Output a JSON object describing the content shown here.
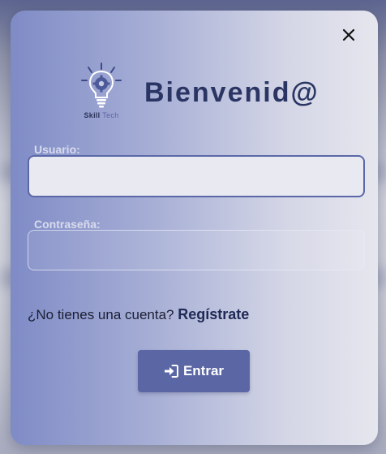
{
  "modal": {
    "brand": {
      "logo_icon": "lightbulb-gear-icon",
      "name_primary": "Skill",
      "name_secondary": "Tech"
    },
    "title": "Bienvenid@",
    "close_icon": "close-icon",
    "form": {
      "username": {
        "label": "Usuario:",
        "value": "",
        "placeholder": ""
      },
      "password": {
        "label": "Contraseña:",
        "value": "",
        "placeholder": ""
      }
    },
    "register": {
      "prompt": "¿No tienes una cuenta?",
      "link_label": "Regístrate"
    },
    "submit": {
      "icon": "sign-in-icon",
      "label": "Entrar"
    }
  },
  "colors": {
    "title": "#2a3563",
    "accent_button": "#5b67a5",
    "input_border_focused": "#5a68a8",
    "label": "#d9dcee"
  }
}
